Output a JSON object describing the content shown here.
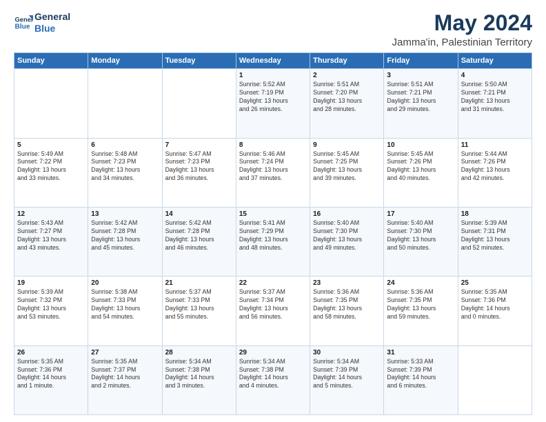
{
  "header": {
    "logo_line1": "General",
    "logo_line2": "Blue",
    "title": "May 2024",
    "subtitle": "Jamma'in, Palestinian Territory"
  },
  "weekdays": [
    "Sunday",
    "Monday",
    "Tuesday",
    "Wednesday",
    "Thursday",
    "Friday",
    "Saturday"
  ],
  "weeks": [
    [
      {
        "day": "",
        "info": ""
      },
      {
        "day": "",
        "info": ""
      },
      {
        "day": "",
        "info": ""
      },
      {
        "day": "1",
        "info": "Sunrise: 5:52 AM\nSunset: 7:19 PM\nDaylight: 13 hours\nand 26 minutes."
      },
      {
        "day": "2",
        "info": "Sunrise: 5:51 AM\nSunset: 7:20 PM\nDaylight: 13 hours\nand 28 minutes."
      },
      {
        "day": "3",
        "info": "Sunrise: 5:51 AM\nSunset: 7:21 PM\nDaylight: 13 hours\nand 29 minutes."
      },
      {
        "day": "4",
        "info": "Sunrise: 5:50 AM\nSunset: 7:21 PM\nDaylight: 13 hours\nand 31 minutes."
      }
    ],
    [
      {
        "day": "5",
        "info": "Sunrise: 5:49 AM\nSunset: 7:22 PM\nDaylight: 13 hours\nand 33 minutes."
      },
      {
        "day": "6",
        "info": "Sunrise: 5:48 AM\nSunset: 7:23 PM\nDaylight: 13 hours\nand 34 minutes."
      },
      {
        "day": "7",
        "info": "Sunrise: 5:47 AM\nSunset: 7:23 PM\nDaylight: 13 hours\nand 36 minutes."
      },
      {
        "day": "8",
        "info": "Sunrise: 5:46 AM\nSunset: 7:24 PM\nDaylight: 13 hours\nand 37 minutes."
      },
      {
        "day": "9",
        "info": "Sunrise: 5:45 AM\nSunset: 7:25 PM\nDaylight: 13 hours\nand 39 minutes."
      },
      {
        "day": "10",
        "info": "Sunrise: 5:45 AM\nSunset: 7:26 PM\nDaylight: 13 hours\nand 40 minutes."
      },
      {
        "day": "11",
        "info": "Sunrise: 5:44 AM\nSunset: 7:26 PM\nDaylight: 13 hours\nand 42 minutes."
      }
    ],
    [
      {
        "day": "12",
        "info": "Sunrise: 5:43 AM\nSunset: 7:27 PM\nDaylight: 13 hours\nand 43 minutes."
      },
      {
        "day": "13",
        "info": "Sunrise: 5:42 AM\nSunset: 7:28 PM\nDaylight: 13 hours\nand 45 minutes."
      },
      {
        "day": "14",
        "info": "Sunrise: 5:42 AM\nSunset: 7:28 PM\nDaylight: 13 hours\nand 46 minutes."
      },
      {
        "day": "15",
        "info": "Sunrise: 5:41 AM\nSunset: 7:29 PM\nDaylight: 13 hours\nand 48 minutes."
      },
      {
        "day": "16",
        "info": "Sunrise: 5:40 AM\nSunset: 7:30 PM\nDaylight: 13 hours\nand 49 minutes."
      },
      {
        "day": "17",
        "info": "Sunrise: 5:40 AM\nSunset: 7:30 PM\nDaylight: 13 hours\nand 50 minutes."
      },
      {
        "day": "18",
        "info": "Sunrise: 5:39 AM\nSunset: 7:31 PM\nDaylight: 13 hours\nand 52 minutes."
      }
    ],
    [
      {
        "day": "19",
        "info": "Sunrise: 5:39 AM\nSunset: 7:32 PM\nDaylight: 13 hours\nand 53 minutes."
      },
      {
        "day": "20",
        "info": "Sunrise: 5:38 AM\nSunset: 7:33 PM\nDaylight: 13 hours\nand 54 minutes."
      },
      {
        "day": "21",
        "info": "Sunrise: 5:37 AM\nSunset: 7:33 PM\nDaylight: 13 hours\nand 55 minutes."
      },
      {
        "day": "22",
        "info": "Sunrise: 5:37 AM\nSunset: 7:34 PM\nDaylight: 13 hours\nand 56 minutes."
      },
      {
        "day": "23",
        "info": "Sunrise: 5:36 AM\nSunset: 7:35 PM\nDaylight: 13 hours\nand 58 minutes."
      },
      {
        "day": "24",
        "info": "Sunrise: 5:36 AM\nSunset: 7:35 PM\nDaylight: 13 hours\nand 59 minutes."
      },
      {
        "day": "25",
        "info": "Sunrise: 5:35 AM\nSunset: 7:36 PM\nDaylight: 14 hours\nand 0 minutes."
      }
    ],
    [
      {
        "day": "26",
        "info": "Sunrise: 5:35 AM\nSunset: 7:36 PM\nDaylight: 14 hours\nand 1 minute."
      },
      {
        "day": "27",
        "info": "Sunrise: 5:35 AM\nSunset: 7:37 PM\nDaylight: 14 hours\nand 2 minutes."
      },
      {
        "day": "28",
        "info": "Sunrise: 5:34 AM\nSunset: 7:38 PM\nDaylight: 14 hours\nand 3 minutes."
      },
      {
        "day": "29",
        "info": "Sunrise: 5:34 AM\nSunset: 7:38 PM\nDaylight: 14 hours\nand 4 minutes."
      },
      {
        "day": "30",
        "info": "Sunrise: 5:34 AM\nSunset: 7:39 PM\nDaylight: 14 hours\nand 5 minutes."
      },
      {
        "day": "31",
        "info": "Sunrise: 5:33 AM\nSunset: 7:39 PM\nDaylight: 14 hours\nand 6 minutes."
      },
      {
        "day": "",
        "info": ""
      }
    ]
  ]
}
